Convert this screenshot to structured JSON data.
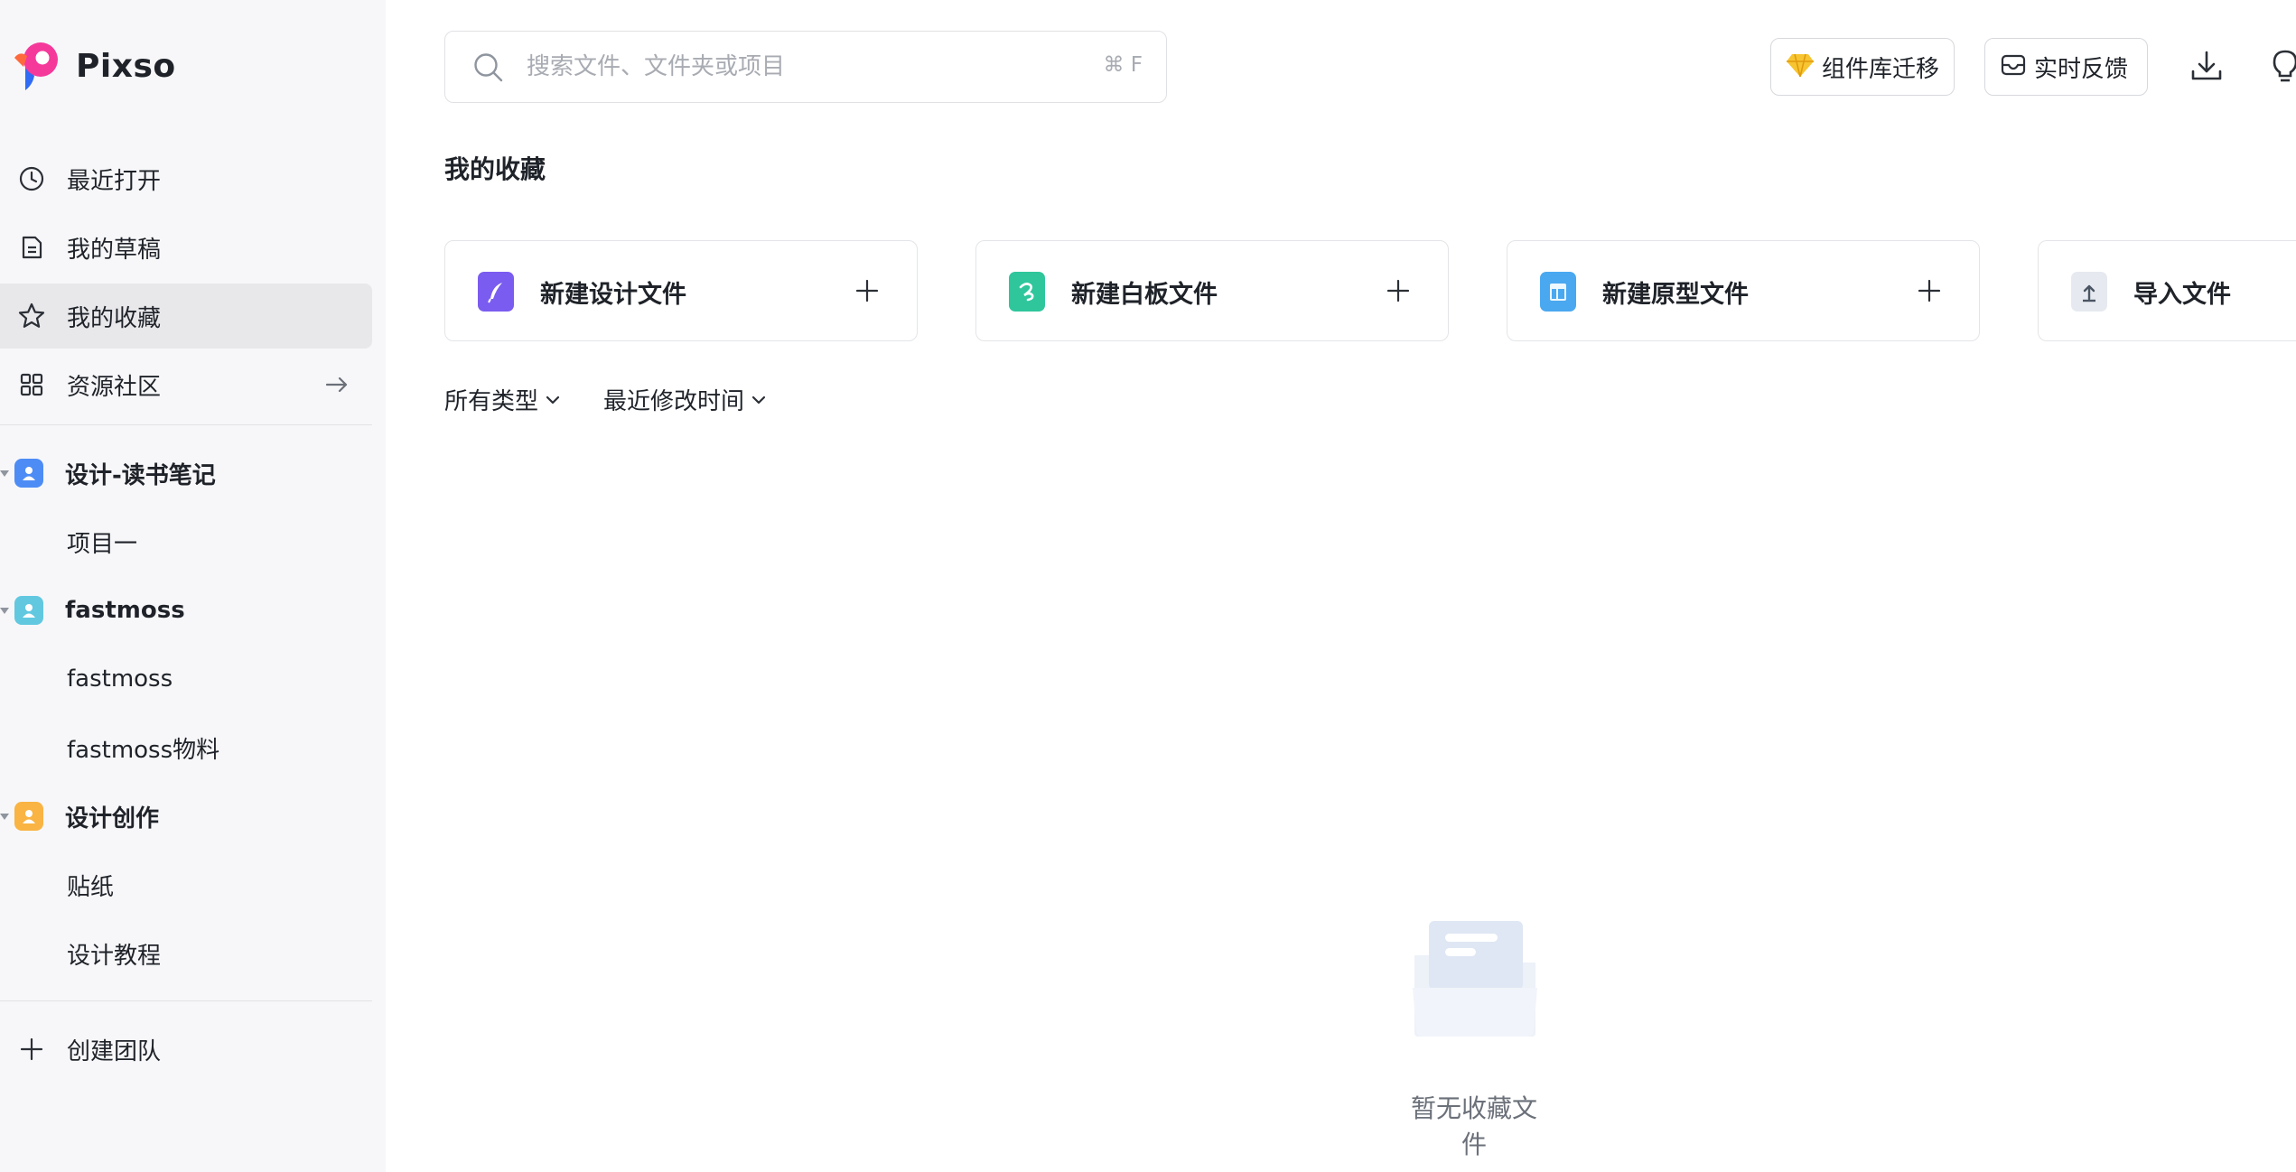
{
  "app": {
    "name": "Pixso"
  },
  "sidebar": {
    "nav": [
      {
        "label": "最近打开",
        "icon": "clock-icon"
      },
      {
        "label": "我的草稿",
        "icon": "draft-file-icon"
      },
      {
        "label": "我的收藏",
        "icon": "star-icon",
        "active": true
      },
      {
        "label": "资源社区",
        "icon": "grid-icon",
        "trailing": "arrow-right-icon"
      }
    ],
    "teams": [
      {
        "name": "设计-读书笔记",
        "avatar_color": "#4d8cf5",
        "projects": [
          "项目一"
        ]
      },
      {
        "name": "fastmoss",
        "avatar_color": "#62c8e0",
        "projects": [
          "fastmoss",
          "fastmoss物料"
        ]
      },
      {
        "name": "设计创作",
        "avatar_color": "#f9b443",
        "projects": [
          "贴纸",
          "设计教程"
        ]
      }
    ],
    "create_team": {
      "label": "创建团队",
      "icon": "plus-icon"
    }
  },
  "search": {
    "placeholder": "搜索文件、文件夹或项目",
    "shortcut": "⌘ F",
    "value": ""
  },
  "toolbar": {
    "library_migrate": {
      "label": "组件库迁移",
      "icon": "diamond-icon"
    },
    "feedback": {
      "label": "实时反馈",
      "icon": "inbox-icon"
    },
    "download": {
      "icon": "download-icon"
    },
    "tips": {
      "icon": "bulb-icon"
    }
  },
  "main": {
    "title": "我的收藏",
    "new_cards": [
      {
        "label": "新建设计文件",
        "icon": "design-file-icon",
        "color": "#7b5cf0"
      },
      {
        "label": "新建白板文件",
        "icon": "whiteboard-file-icon",
        "color": "#2fc69c"
      },
      {
        "label": "新建原型文件",
        "icon": "prototype-file-icon",
        "color": "#4aa8f0"
      },
      {
        "label": "导入文件",
        "icon": "import-file-icon",
        "color": "#e6e9ef"
      }
    ],
    "filters": {
      "type": "所有类型",
      "sort": "最近修改时间"
    },
    "empty_state": {
      "text": "暂无收藏文件"
    }
  }
}
